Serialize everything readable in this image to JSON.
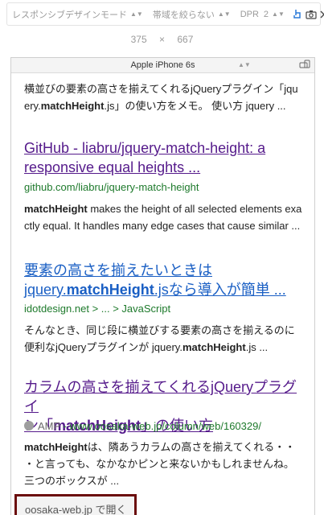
{
  "toolbar": {
    "responsive_mode": "レスポンシブデザインモード",
    "bandwidth": "帯域を絞らない",
    "dpr_label": "DPR",
    "dpr_value": "2"
  },
  "viewport": {
    "width": "375",
    "times": "×",
    "height": "667"
  },
  "device": {
    "name": "Apple iPhone 6s"
  },
  "results": {
    "r0_snippet_1": "横並びの要素の高さを揃えてくれるjQueryプラグイン「jqu",
    "r0_snippet_2a": "ery.",
    "r0_snippet_2b": "matchHeight",
    "r0_snippet_2c": ".js」の使い方をメモ。 使い方 jquery ...",
    "r1_title_1": "GitHub - liabru/jquery-match-height: a",
    "r1_title_2": "responsive equal heights ...",
    "r1_url": "github.com/liabru/jquery-match-height",
    "r1_snippet_1a": "matchHeight",
    "r1_snippet_1b": " makes the height of all selected elements exa",
    "r1_snippet_2": "ctly equal. It handles many edge cases that cause similar ...",
    "r2_title_1": "要素の高さを揃えたいときは",
    "r2_title_2a": "jquery.",
    "r2_title_2b": "matchHeight",
    "r2_title_2c": ".jsなら導入が簡単 ...",
    "r2_url": "idotdesign.net > ... > JavaScript",
    "r2_snippet_1": "そんなとき、同じ段に横並びする要素の高さを揃えるのに",
    "r2_snippet_2a": "便利なjQueryプラグインが jquery.",
    "r2_snippet_2b": "matchHeight",
    "r2_snippet_2c": ".js ...",
    "r3_title_1": "カラムの高さを揃えてくれるjQueryプラグイ",
    "r3_title_2a": "ン「",
    "r3_title_2b": "matchHeight",
    "r3_title_2c": "」の使い方",
    "r3_amp": "AMP",
    "r3_url": " - www.oosaka-web.jp/column/web/160329/",
    "r3_snippet_1a": "matchHeight",
    "r3_snippet_1b": "は、隣あうカラムの高さを揃えてくれる・・",
    "r3_snippet_2": "・と言っても、なかなかピンと来ないかもしれませんね。",
    "r3_snippet_3": "三つのボックスが ..."
  },
  "open_button": {
    "label": "oosaka-web.jp で開く"
  },
  "colors": {
    "visited_link": "#551a8b",
    "link": "#1a5fc4",
    "url_green": "#1e7a2c",
    "highlight_border": "#6b0d0d"
  }
}
